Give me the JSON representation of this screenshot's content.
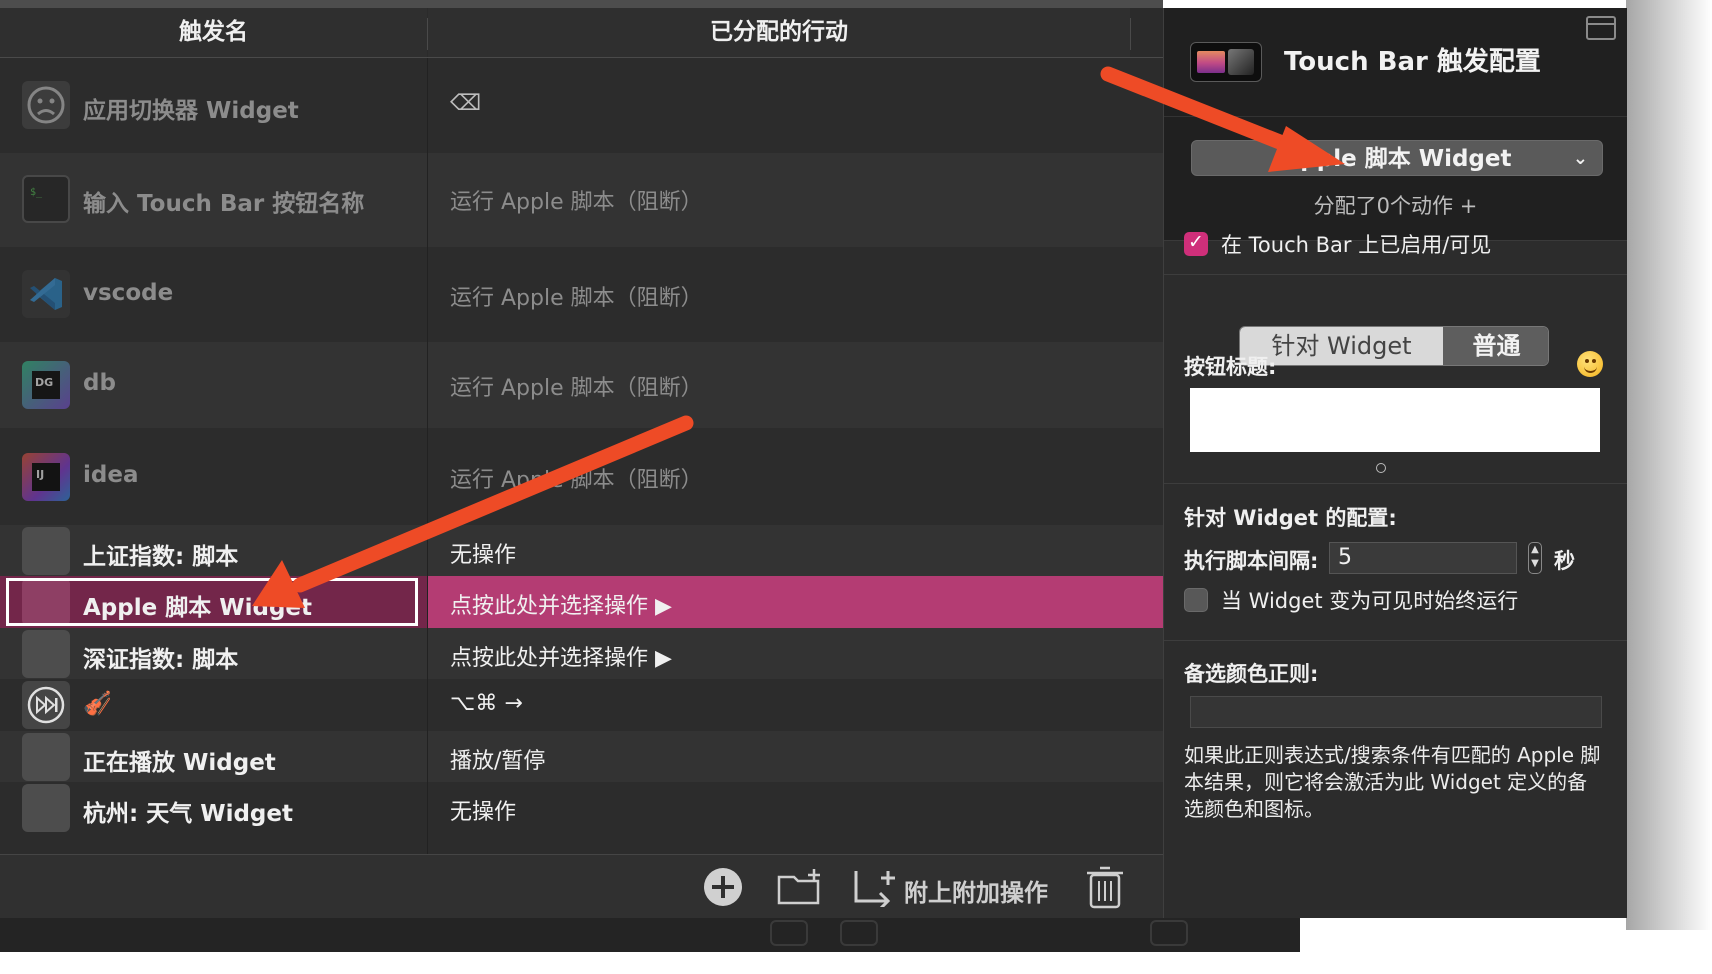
{
  "table": {
    "col_trigger": "触发名",
    "col_action": "已分配的行动"
  },
  "rows": [
    {
      "name": "应用切换器 Widget",
      "action": "⌫",
      "icon": "sad-face-icon"
    },
    {
      "name": "输入 Touch Bar 按钮名称",
      "action": "运行 Apple 脚本（阻断）",
      "icon": "terminal-icon"
    },
    {
      "name": "vscode",
      "action": "运行 Apple 脚本（阻断）",
      "icon": "vscode-icon"
    },
    {
      "name": "db",
      "action": "运行 Apple 脚本（阻断）",
      "icon": "datagrip-icon"
    },
    {
      "name": "idea",
      "action": "运行 Apple 脚本（阻断）",
      "icon": "intellij-icon"
    },
    {
      "name": "上证指数: 脚本",
      "action": "无操作",
      "icon": "blank-icon"
    },
    {
      "name": "Apple 脚本 Widget",
      "action": "点按此处并选择操作 ▶",
      "icon": "blank-icon"
    },
    {
      "name": "深证指数: 脚本",
      "action": "点按此处并选择操作 ▶",
      "icon": "blank-icon"
    },
    {
      "name": "🎻",
      "action": "⌥⌘ →",
      "icon": "fast-forward-icon"
    },
    {
      "name": "正在播放 Widget",
      "action": "播放/暂停",
      "icon": "blank-icon"
    },
    {
      "name": "杭州: 天气 Widget",
      "action": "无操作",
      "icon": "blank-icon"
    }
  ],
  "bottom_bar": {
    "attach_label": "附上附加操作"
  },
  "panel": {
    "title": "Touch Bar 触发配置",
    "widget_type": "Apple 脚本 Widget",
    "assigned": "分配了0个动作 +",
    "enabled_label": "在 Touch Bar 上已启用/可见",
    "enabled": true,
    "seg_widget": "针对 Widget",
    "seg_general": "普通",
    "button_title_label": "按钮标题:",
    "button_title_value": "",
    "widget_config_label": "针对 Widget 的配置:",
    "interval_label": "执行脚本间隔:",
    "interval_value": "5",
    "interval_unit": "秒",
    "always_run_label": "当 Widget 变为可见时始终运行",
    "always_run": false,
    "alt_color_label": "备选颜色正则:",
    "alt_color_value": "",
    "help_text": "如果此正则表达式/搜索条件有匹配的 Apple 脚本结果，则它将会激活为此 Widget 定义的备选颜色和图标。"
  },
  "colors": {
    "accent": "#cf2f7a",
    "selected_action_bg": "#b43c73",
    "selected_trigger_bg": "#73264a",
    "annotation_arrow": "#ee4b26"
  }
}
